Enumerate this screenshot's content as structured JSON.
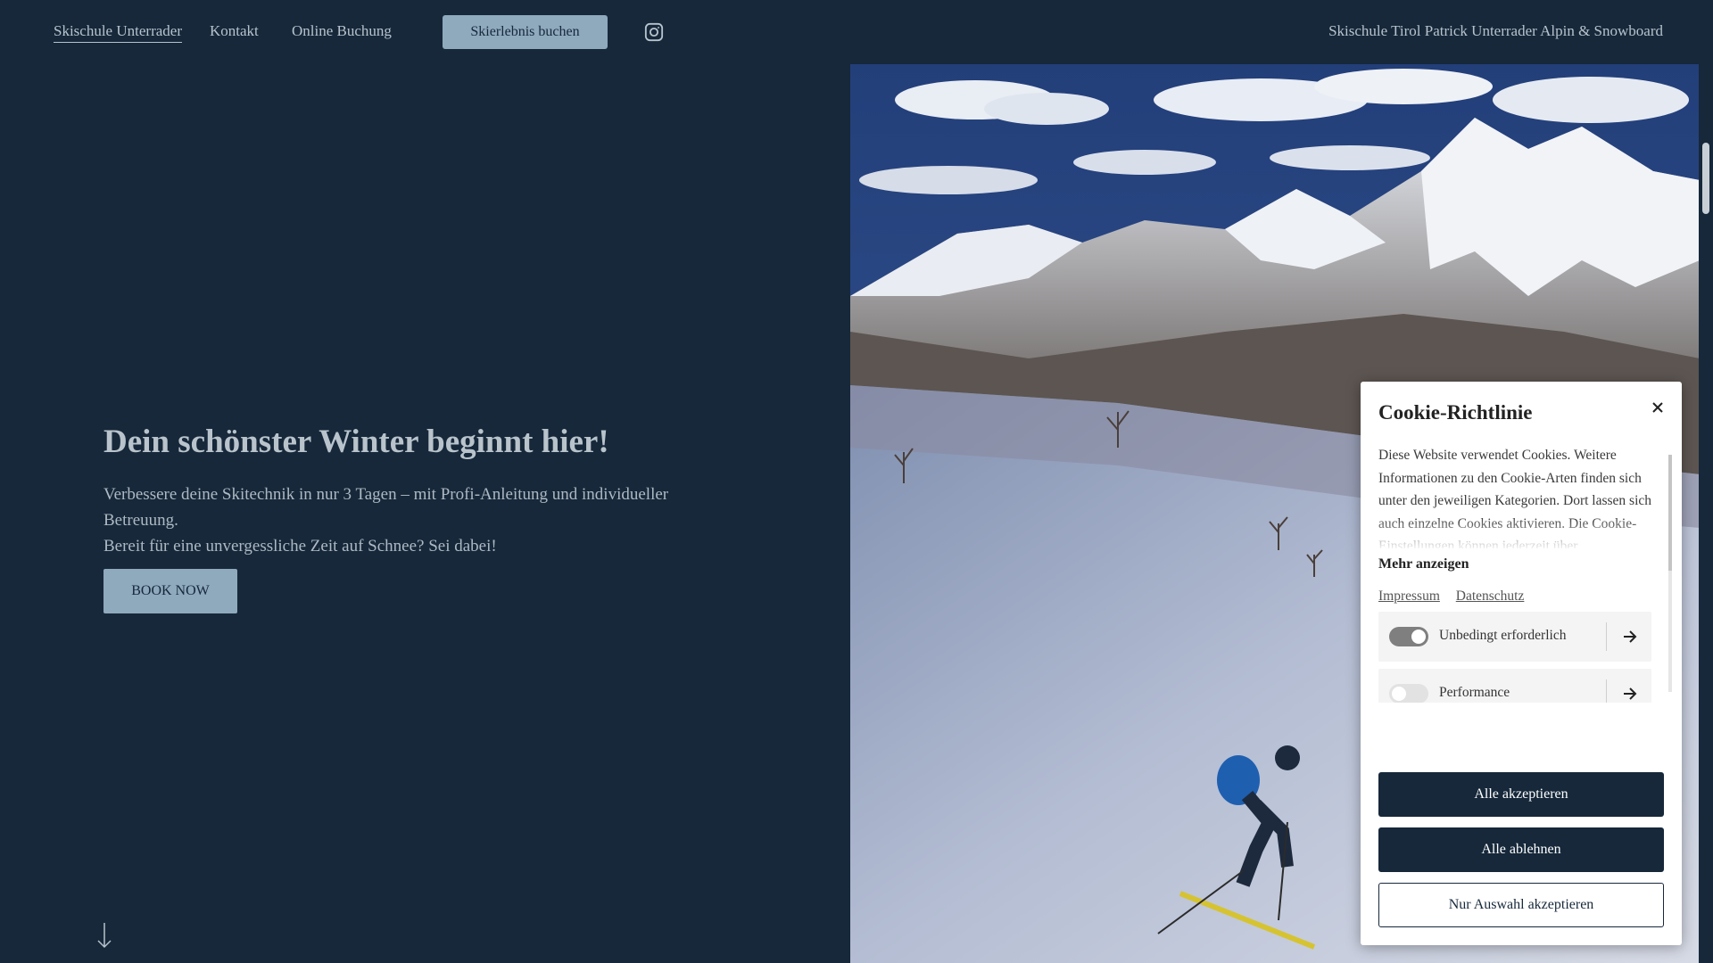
{
  "nav": {
    "items": [
      {
        "label": "Skischule Unterrader",
        "active": true
      },
      {
        "label": "Kontakt",
        "active": false
      },
      {
        "label": "Online Buchung",
        "active": false
      }
    ],
    "cta_label": "Skierlebnis buchen",
    "instagram_icon": "instagram-icon",
    "brand": "Skischule Tirol Patrick Unterrader Alpin & Snowboard"
  },
  "hero": {
    "title": "Dein schönster Winter beginnt hier!",
    "text_line1": "Verbessere deine Skitechnik in nur 3 Tagen – mit Profi-Anleitung und individueller Betreuung.",
    "text_line2": "Bereit für eine unvergessliche Zeit auf Schnee? Sei dabei!",
    "button_label": "BOOK NOW",
    "scroll_icon": "arrow-down-icon"
  },
  "cookie": {
    "title": "Cookie-Richtlinie",
    "description": "Diese Website verwendet Cookies. Weitere Informationen zu den Cookie-Arten finden sich unter den jeweiligen Kategorien. Dort lassen sich auch einzelne Cookies aktivieren. Die Cookie-Einstellungen können jederzeit über",
    "more": "Mehr anzeigen",
    "links": [
      "Impressum",
      "Datenschutz"
    ],
    "categories": [
      {
        "label": "Unbedingt erforderlich",
        "enabled": true
      },
      {
        "label": "Performance",
        "enabled": false
      }
    ],
    "accept_all": "Alle akzeptieren",
    "reject_all": "Alle ablehnen",
    "accept_selection": "Nur Auswahl akzeptieren"
  },
  "colors": {
    "background": "#16283a",
    "accent_button": "#8fa9bd",
    "modal_button": "#16283a"
  }
}
